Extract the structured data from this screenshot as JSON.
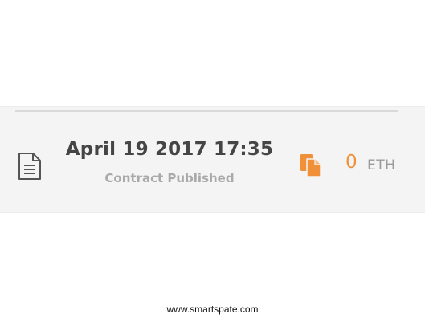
{
  "activity": {
    "date": "April 19 2017 17:35",
    "status": "Contract Published",
    "amount": "0",
    "currency": "ETH",
    "icons": {
      "left": "document-icon",
      "right": "copy-icon"
    },
    "colors": {
      "accent": "#f0913a",
      "date_text": "#454545",
      "status_text": "#a9a9a9",
      "row_background": "#f4f4f4"
    }
  },
  "footer": {
    "text": "www.smartspate.com"
  }
}
